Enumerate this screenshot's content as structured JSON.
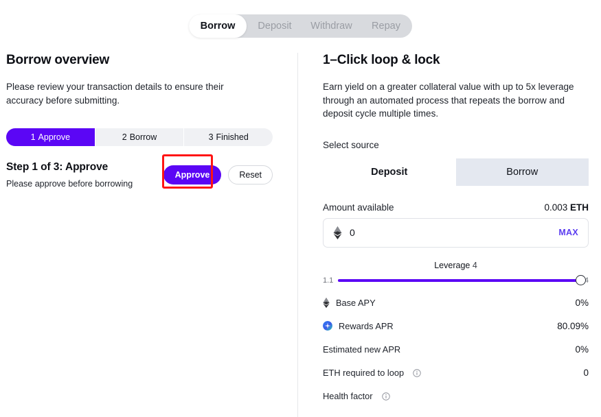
{
  "tabs": {
    "items": [
      {
        "label": "Borrow",
        "active": true
      },
      {
        "label": "Deposit",
        "active": false
      },
      {
        "label": "Withdraw",
        "active": false
      },
      {
        "label": "Repay",
        "active": false
      }
    ]
  },
  "left": {
    "title": "Borrow overview",
    "description": "Please review your transaction details to ensure their accuracy before submitting.",
    "stepper": [
      {
        "num": "1",
        "label": "Approve",
        "active": true
      },
      {
        "num": "2",
        "label": "Borrow",
        "active": false
      },
      {
        "num": "3",
        "label": "Finished",
        "active": false
      }
    ],
    "step_heading": "Step 1 of 3: Approve",
    "step_sub": "Please approve before borrowing",
    "approve_label": "Approve",
    "reset_label": "Reset"
  },
  "right": {
    "title": "1–Click loop & lock",
    "description": "Earn yield on a greater collateral value with up to 5x leverage through an automated process that repeats the borrow and deposit cycle multiple times.",
    "select_source_label": "Select source",
    "source_tabs": [
      {
        "label": "Deposit",
        "active": true
      },
      {
        "label": "Borrow",
        "active": false
      }
    ],
    "amount_label": "Amount available",
    "amount_available_value": "0.003",
    "amount_available_unit": "ETH",
    "amount_input_value": "0",
    "amount_input_placeholder": "0",
    "max_label": "MAX",
    "leverage_label": "Leverage",
    "leverage_value": "4",
    "slider_min": "1.1",
    "slider_max": "4",
    "stats": [
      {
        "label": "Base APY",
        "value": "0%",
        "icon": "eth-icon"
      },
      {
        "label": "Rewards APR",
        "value": "80.09%",
        "icon": "rewards-icon"
      },
      {
        "label": "Estimated new APR",
        "value": "0%",
        "icon": ""
      },
      {
        "label": "ETH required to loop",
        "value": "0",
        "icon": "",
        "info": true
      },
      {
        "label": "Health factor",
        "value": "",
        "icon": "",
        "info": true
      }
    ]
  },
  "colors": {
    "accent_purple": "#5b06f5",
    "max_purple": "#5b3df0",
    "highlight_red": "#ff1414",
    "tabbar_gray": "#d8dade",
    "stepper_gray": "#f0f1f4",
    "source_tab_gray": "#e4e8f0"
  }
}
